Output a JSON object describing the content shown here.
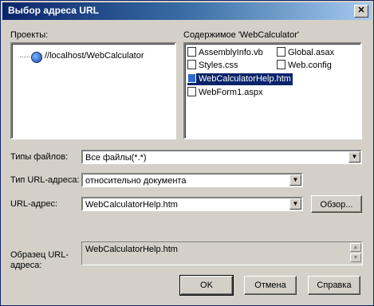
{
  "window": {
    "title": "Выбор адреса URL",
    "close_glyph": "✕"
  },
  "projects": {
    "label": "Проекты:",
    "tree": [
      {
        "label": "//localhost/WebCalculator",
        "icon": "web-project-icon"
      }
    ]
  },
  "contents": {
    "label": "Содержимое 'WebCalculator'",
    "files": [
      {
        "name": "AssemblyInfo.vb",
        "icon": "file-icon"
      },
      {
        "name": "Global.asax",
        "icon": "file-icon"
      },
      {
        "name": "Styles.css",
        "icon": "file-icon"
      },
      {
        "name": "Web.config",
        "icon": "file-icon"
      },
      {
        "name": "WebCalculatorHelp.htm",
        "icon": "html-file-icon",
        "selected": true
      },
      {
        "name": "WebForm1.aspx",
        "icon": "file-icon"
      }
    ]
  },
  "file_types": {
    "label": "Типы файлов:",
    "value": "Все файлы(*.*)"
  },
  "url_type": {
    "label": "Тип URL-адреса:",
    "value": "относительно документа"
  },
  "url": {
    "label": "URL-адрес:",
    "value": "WebCalculatorHelp.htm",
    "browse_label": "Обзор..."
  },
  "sample": {
    "label": "Образец URL-адреса:",
    "value": "WebCalculatorHelp.htm"
  },
  "buttons": {
    "ok": "OK",
    "cancel": "Отмена",
    "help": "Справка"
  },
  "colors": {
    "titlebar": "#0a246a",
    "selection": "#0a246a",
    "face": "#d4d0c8"
  }
}
